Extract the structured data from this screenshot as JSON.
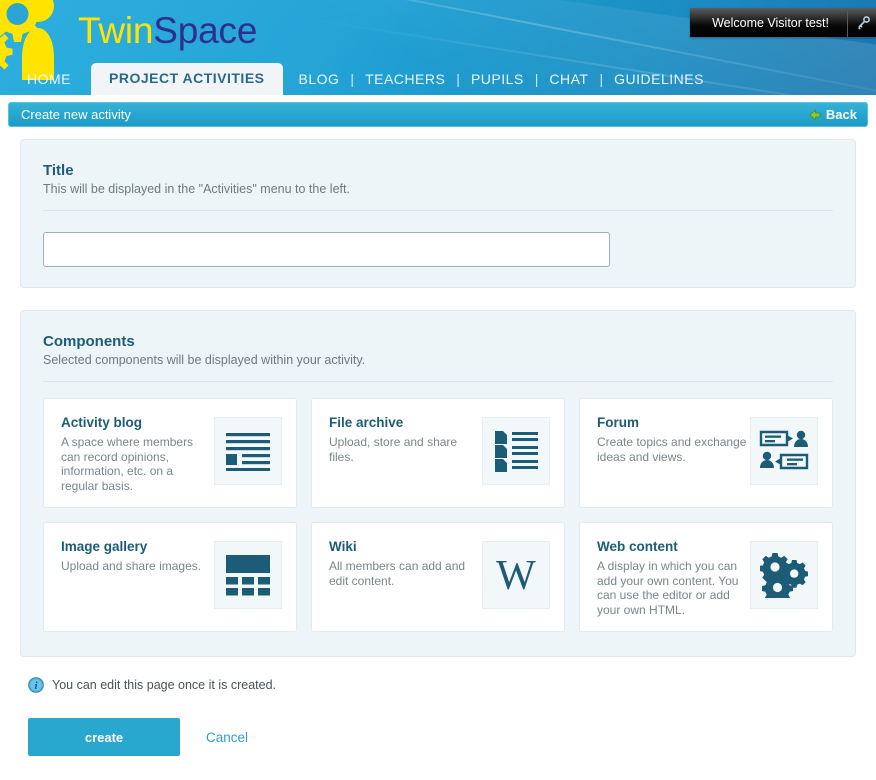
{
  "header": {
    "brand_first": "Twin",
    "brand_second": "Space",
    "welcome_text": "Welcome Visitor test!",
    "welcome_icon": "key-icon",
    "logo_icon": "gears-person-logo-icon",
    "nav": [
      {
        "label": "HOME",
        "active": false
      },
      {
        "label": "PROJECT ACTIVITIES",
        "active": true
      },
      {
        "label": "BLOG",
        "active": false
      },
      {
        "label": "TEACHERS",
        "active": false
      },
      {
        "label": "PUPILS",
        "active": false
      },
      {
        "label": "CHAT",
        "active": false
      },
      {
        "label": "GUIDELINES",
        "active": false
      }
    ],
    "nav_separator": "|"
  },
  "title_bar": {
    "text": "Create new activity",
    "back_label": "Back",
    "back_icon": "arrow-left-icon"
  },
  "title_section": {
    "heading": "Title",
    "description": "This will be displayed in the \"Activities\" menu to the left.",
    "input_value": "",
    "input_placeholder": ""
  },
  "components_section": {
    "heading": "Components",
    "description": "Selected components will be displayed within your activity.",
    "cards": [
      {
        "title": "Activity blog",
        "description": "A space where members can record opinions, information, etc. on a regular basis.",
        "icon": "blog-lines-icon"
      },
      {
        "title": "File archive",
        "description": "Upload, store and share files.",
        "icon": "file-list-icon"
      },
      {
        "title": "Forum",
        "description": "Create topics and exchange ideas and views.",
        "icon": "forum-speech-bubbles-icon"
      },
      {
        "title": "Image gallery",
        "description": "Upload and share images.",
        "icon": "image-grid-icon"
      },
      {
        "title": "Wiki",
        "description": "All members can add and edit content.",
        "icon": "wiki-w-icon"
      },
      {
        "title": "Web content",
        "description": "A display in which you can add your own content. You can use the editor or add your own HTML.",
        "icon": "gears-icon"
      }
    ]
  },
  "footer": {
    "note": "You can edit this page once it is created.",
    "note_icon": "info-icon",
    "create_label": "create",
    "cancel_label": "Cancel"
  },
  "colors": {
    "header_cyan": "#1fa9dc",
    "header_blue": "#1a75ad",
    "logo_yellow": "#ffe400",
    "brand_purple": "#2f2f8f",
    "title_bar": "#27a6cf",
    "panel_bg": "#eef5f8",
    "heading_teal": "#1d5c77",
    "icon_navy": "#1d5c77",
    "button_cyan": "#29a8cf",
    "link_cyan": "#2f9fc6",
    "back_arrow_green": "#6aa828"
  }
}
